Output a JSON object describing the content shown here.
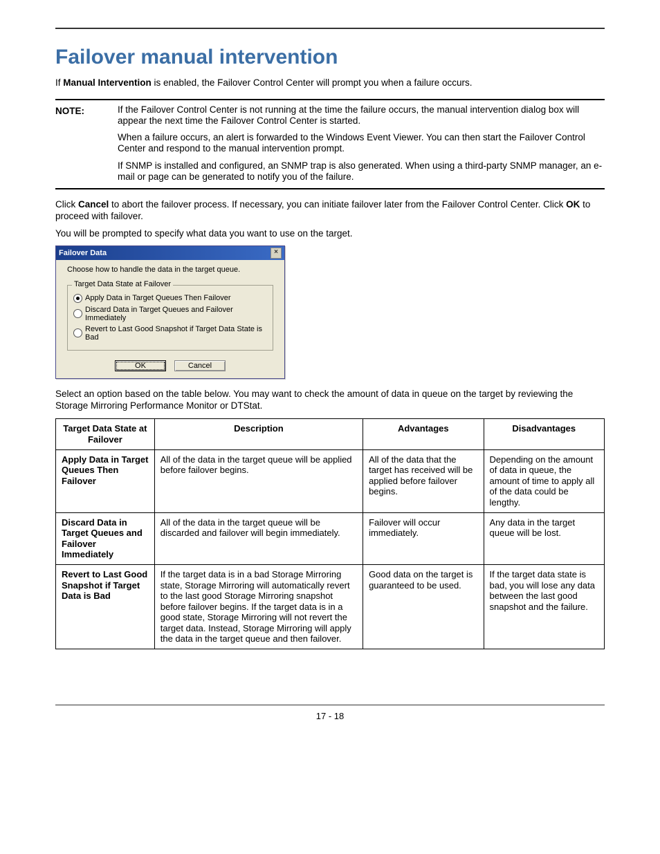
{
  "title": "Failover manual intervention",
  "intro": {
    "pre": "If ",
    "bold": "Manual Intervention",
    "post": " is enabled, the Failover Control Center will prompt you when a failure occurs."
  },
  "note": {
    "label": "NOTE:",
    "paragraphs": [
      "If the Failover Control Center is not running at the time the failure occurs, the manual intervention dialog box will appear the next time the Failover Control Center is started.",
      "When a failure occurs, an alert is forwarded to the Windows Event Viewer. You can then start the Failover Control Center and respond to the manual intervention prompt.",
      "If SNMP is installed and configured, an SNMP trap is also generated. When using a third-party SNMP manager, an e-mail or page can be generated to notify you of the failure."
    ]
  },
  "after_note": {
    "p1_pre": "Click ",
    "p1_b1": "Cancel",
    "p1_mid": " to abort the failover process. If necessary, you can initiate failover later from the Failover Control Center. Click ",
    "p1_b2": "OK",
    "p1_post": " to proceed with failover.",
    "p2": "You will be prompted to specify what data you want to use on the target."
  },
  "dialog": {
    "title": "Failover Data",
    "close_glyph": "×",
    "instruction": "Choose how to handle the data in the target queue.",
    "group_legend": "Target Data State at Failover",
    "options": [
      {
        "label": "Apply Data in Target Queues Then Failover",
        "selected": true
      },
      {
        "label": "Discard Data in Target Queues and Failover Immediately",
        "selected": false
      },
      {
        "label": "Revert to Last Good Snapshot if Target Data State is Bad",
        "selected": false
      }
    ],
    "ok": "OK",
    "cancel": "Cancel"
  },
  "select_text": "Select an option based on the table below. You may want to check the amount of data in queue on the target by reviewing the Storage Mirroring Performance Monitor or DTStat.",
  "table": {
    "headers": [
      "Target Data State at Failover",
      "Description",
      "Advantages",
      "Disadvantages"
    ],
    "rows": [
      {
        "name": "Apply Data in Target Queues Then Failover",
        "desc": "All of the data in the target queue will be applied before failover begins.",
        "adv": "All of the data that the target has received will be applied before failover begins.",
        "dis": "Depending on the amount of data in queue, the amount of time to apply all of the data could be lengthy."
      },
      {
        "name": "Discard Data in Target Queues and Failover Immediately",
        "desc": "All of the data in the target queue will be discarded and failover will begin immediately.",
        "adv": "Failover will occur immediately.",
        "dis": "Any data in the target queue will be lost."
      },
      {
        "name": "Revert to Last Good Snapshot if Target Data is Bad",
        "desc": "If the target data is in a bad Storage Mirroring state, Storage Mirroring will automatically revert to the last good Storage Mirroring snapshot before failover begins. If the target data is in a good state, Storage Mirroring will not revert the target data. Instead, Storage Mirroring will apply the data in the target queue and then failover.",
        "adv": "Good data on the target is guaranteed to be used.",
        "dis": "If the target data state is bad, you will lose any data between the last good snapshot and the failure."
      }
    ]
  },
  "page_num": "17 - 18"
}
